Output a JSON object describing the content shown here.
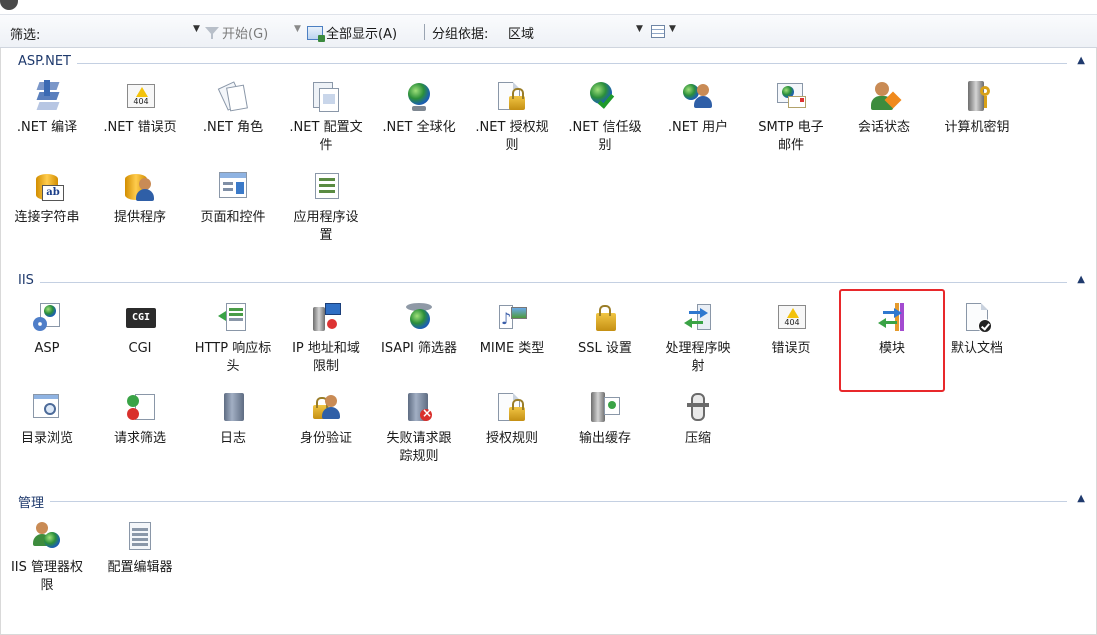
{
  "toolbar": {
    "filter_label": "筛选:",
    "filter_value": "",
    "start_label": "开始(G)",
    "show_all_label": "全部显示(A)",
    "group_by_label": "分组依据:",
    "group_by_value": "区域"
  },
  "groups": [
    {
      "title": "ASP.NET",
      "items": [
        {
          "label": ".NET 编译",
          "icon": "compile-icon"
        },
        {
          "label": ".NET 错误页",
          "icon": "error-page-icon"
        },
        {
          "label": ".NET 角色",
          "icon": "roles-icon"
        },
        {
          "label": ".NET 配置文件",
          "icon": "profile-icon"
        },
        {
          "label": ".NET 全球化",
          "icon": "globe-icon"
        },
        {
          "label": ".NET 授权规则",
          "icon": "authorization-icon"
        },
        {
          "label": ".NET 信任级别",
          "icon": "trust-level-icon"
        },
        {
          "label": ".NET 用户",
          "icon": "users-icon"
        },
        {
          "label": "SMTP 电子邮件",
          "icon": "smtp-icon"
        },
        {
          "label": "会话状态",
          "icon": "session-state-icon"
        },
        {
          "label": "计算机密钥",
          "icon": "machine-key-icon"
        },
        {
          "label": "连接字符串",
          "icon": "connection-string-icon"
        },
        {
          "label": "提供程序",
          "icon": "providers-icon"
        },
        {
          "label": "页面和控件",
          "icon": "pages-controls-icon"
        },
        {
          "label": "应用程序设置",
          "icon": "app-settings-icon"
        }
      ]
    },
    {
      "title": "IIS",
      "items": [
        {
          "label": "ASP",
          "icon": "asp-icon"
        },
        {
          "label": "CGI",
          "icon": "cgi-icon"
        },
        {
          "label": "HTTP 响应标头",
          "icon": "http-headers-icon"
        },
        {
          "label": "IP 地址和域限制",
          "icon": "ip-restrictions-icon"
        },
        {
          "label": "ISAPI 筛选器",
          "icon": "isapi-filter-icon"
        },
        {
          "label": "MIME 类型",
          "icon": "mime-types-icon"
        },
        {
          "label": "SSL 设置",
          "icon": "ssl-lock-icon"
        },
        {
          "label": "处理程序映射",
          "icon": "handler-mappings-icon"
        },
        {
          "label": "错误页",
          "icon": "error-page-icon"
        },
        {
          "label": "模块",
          "icon": "modules-icon"
        },
        {
          "label": "默认文档",
          "icon": "default-document-icon"
        },
        {
          "label": "目录浏览",
          "icon": "directory-browsing-icon"
        },
        {
          "label": "请求筛选",
          "icon": "request-filtering-icon"
        },
        {
          "label": "日志",
          "icon": "logging-icon"
        },
        {
          "label": "身份验证",
          "icon": "authentication-icon"
        },
        {
          "label": "失败请求跟踪规则",
          "icon": "failed-request-tracing-icon"
        },
        {
          "label": "授权规则",
          "icon": "authorization-icon"
        },
        {
          "label": "输出缓存",
          "icon": "output-caching-icon"
        },
        {
          "label": "压缩",
          "icon": "compression-icon"
        }
      ]
    },
    {
      "title": "管理",
      "items": [
        {
          "label": "IIS 管理器权限",
          "icon": "iis-manager-permissions-icon"
        },
        {
          "label": "配置编辑器",
          "icon": "configuration-editor-icon"
        }
      ]
    }
  ],
  "labels_split": {
    "net_config_1": ".NET 配置文",
    "net_config_2": "件",
    "net_auth_1": ".NET 授权规",
    "net_auth_2": "则",
    "net_trust_1": ".NET 信任级",
    "net_trust_2": "别",
    "smtp_1": "SMTP 电子",
    "smtp_2": "邮件",
    "app_settings_1": "应用程序设",
    "app_settings_2": "置",
    "http_1": "HTTP 响应标",
    "http_2": "头",
    "ip_1": "IP 地址和域",
    "ip_2": "限制",
    "handler_1": "处理程序映",
    "handler_2": "射",
    "failed_1": "失败请求跟",
    "failed_2": "踪规则",
    "iisperm_1": "IIS 管理器权",
    "iisperm_2": "限"
  },
  "selected_item": "模块",
  "colors": {
    "selection_border": "#e8282b",
    "group_title": "#1f3a6d"
  }
}
